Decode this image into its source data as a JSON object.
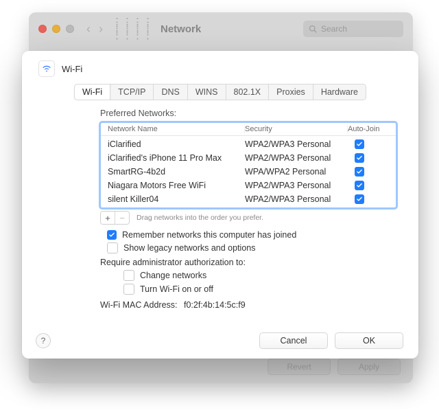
{
  "back": {
    "title": "Network",
    "search_placeholder": "Search",
    "revert": "Revert",
    "apply": "Apply"
  },
  "sheet": {
    "title": "Wi-Fi",
    "tabs": [
      "Wi-Fi",
      "TCP/IP",
      "DNS",
      "WINS",
      "802.1X",
      "Proxies",
      "Hardware"
    ],
    "active_tab": 0,
    "preferred_label": "Preferred Networks:",
    "columns": {
      "name": "Network Name",
      "security": "Security",
      "auto": "Auto-Join"
    },
    "networks": [
      {
        "name": "iClarified",
        "security": "WPA2/WPA3 Personal",
        "auto": true
      },
      {
        "name": "iClarified's iPhone 11 Pro Max",
        "security": "WPA2/WPA3 Personal",
        "auto": true
      },
      {
        "name": "SmartRG-4b2d",
        "security": "WPA/WPA2 Personal",
        "auto": true
      },
      {
        "name": "Niagara Motors Free WiFi",
        "security": "WPA2/WPA3 Personal",
        "auto": true
      },
      {
        "name": "silent Killer04",
        "security": "WPA2/WPA3 Personal",
        "auto": true
      }
    ],
    "drag_hint": "Drag networks into the order you prefer.",
    "add_label": "+",
    "remove_label": "−",
    "remember": {
      "label": "Remember networks this computer has joined",
      "checked": true
    },
    "legacy": {
      "label": "Show legacy networks and options",
      "checked": false
    },
    "admin_label": "Require administrator authorization to:",
    "change_nets": {
      "label": "Change networks",
      "checked": false
    },
    "wifi_toggle": {
      "label": "Turn Wi-Fi on or off",
      "checked": false
    },
    "mac_label": "Wi-Fi MAC Address:",
    "mac_value": "f0:2f:4b:14:5c:f9",
    "help": "?",
    "cancel": "Cancel",
    "ok": "OK"
  }
}
